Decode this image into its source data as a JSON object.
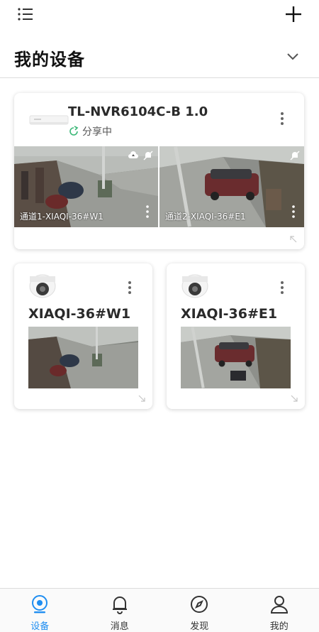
{
  "header": {
    "title": "我的设备"
  },
  "nvr": {
    "name": "TL-NVR6104C-B 1.0",
    "share_status": "分享中",
    "channels": [
      {
        "label": "通道1-XIAQI-36#W1"
      },
      {
        "label": "通道2-XIAQI-36#E1"
      }
    ]
  },
  "cameras": [
    {
      "name": "XIAQI-36#W1"
    },
    {
      "name": "XIAQI-36#E1"
    }
  ],
  "tabs": [
    {
      "label": "设备",
      "icon": "device-icon",
      "active": true
    },
    {
      "label": "消息",
      "icon": "bell-icon",
      "active": false
    },
    {
      "label": "发现",
      "icon": "compass-icon",
      "active": false
    },
    {
      "label": "我的",
      "icon": "user-icon",
      "active": false
    }
  ],
  "colors": {
    "accent": "#1f8ef1",
    "share_green": "#3cb878"
  }
}
